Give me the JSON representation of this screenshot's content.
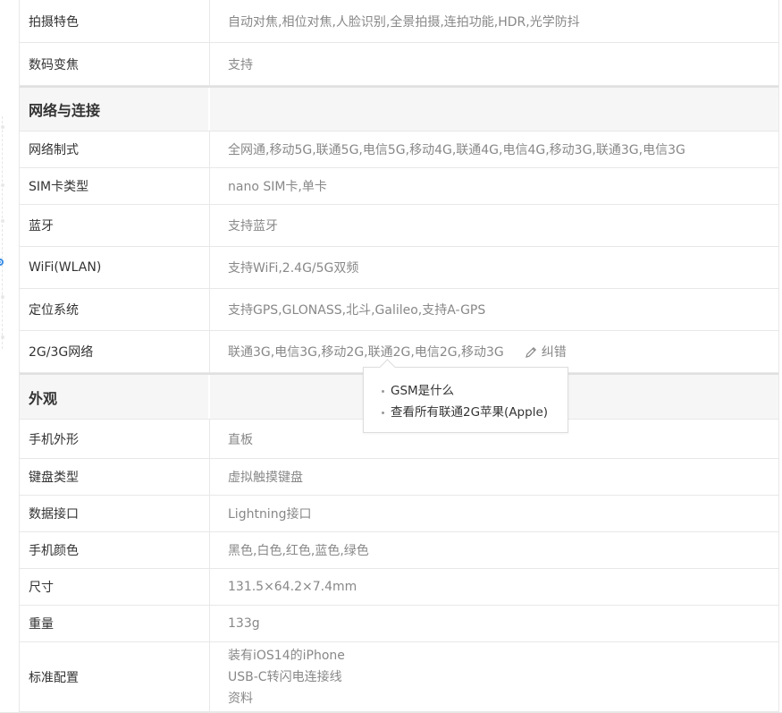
{
  "rows": {
    "shooting_features": {
      "label": "拍摄特色",
      "value": "自动对焦,相位对焦,人脸识别,全景拍摄,连拍功能,HDR,光学防抖"
    },
    "digital_zoom": {
      "label": "数码变焦",
      "value": "支持"
    },
    "network_type": {
      "label": "网络制式",
      "value": "全网通,移动5G,联通5G,电信5G,移动4G,联通4G,电信4G,移动3G,联通3G,电信3G"
    },
    "sim_type": {
      "label": "SIM卡类型",
      "value": "nano SIM卡,单卡"
    },
    "bluetooth": {
      "label": "蓝牙",
      "value": "支持蓝牙"
    },
    "wifi": {
      "label": "WiFi(WLAN)",
      "value": "支持WiFi,2.4G/5G双频"
    },
    "positioning": {
      "label": "定位系统",
      "value": "支持GPS,GLONASS,北斗,Galileo,支持A-GPS"
    },
    "network_2g3g": {
      "label": "2G/3G网络",
      "value": "联通3G,电信3G,移动2G,联通2G,电信2G,移动3G",
      "edit_label": "纠错"
    },
    "phone_form": {
      "label": "手机外形",
      "value": "直板"
    },
    "keyboard": {
      "label": "键盘类型",
      "value": "虚拟触摸键盘"
    },
    "data_port": {
      "label": "数据接口",
      "value": "Lightning接口"
    },
    "colors": {
      "label": "手机颜色",
      "value": "黑色,白色,红色,蓝色,绿色"
    },
    "size": {
      "label": "尺寸",
      "value": "131.5×64.2×7.4mm"
    },
    "weight": {
      "label": "重量",
      "value": "133g"
    },
    "standard_config": {
      "label": "标准配置",
      "values": [
        "装有iOS14的iPhone",
        "USB-C转闪电连接线",
        "资料"
      ]
    }
  },
  "sections": {
    "network": "网络与连接",
    "appearance": "外观"
  },
  "popup": {
    "items": [
      "GSM是什么",
      "查看所有联通2G苹果(Apple)"
    ]
  },
  "colors": {
    "accent": "#3a8ee6",
    "border": "#e8e8e8",
    "section_bg": "#f6f6f6",
    "value_text": "#888888"
  }
}
